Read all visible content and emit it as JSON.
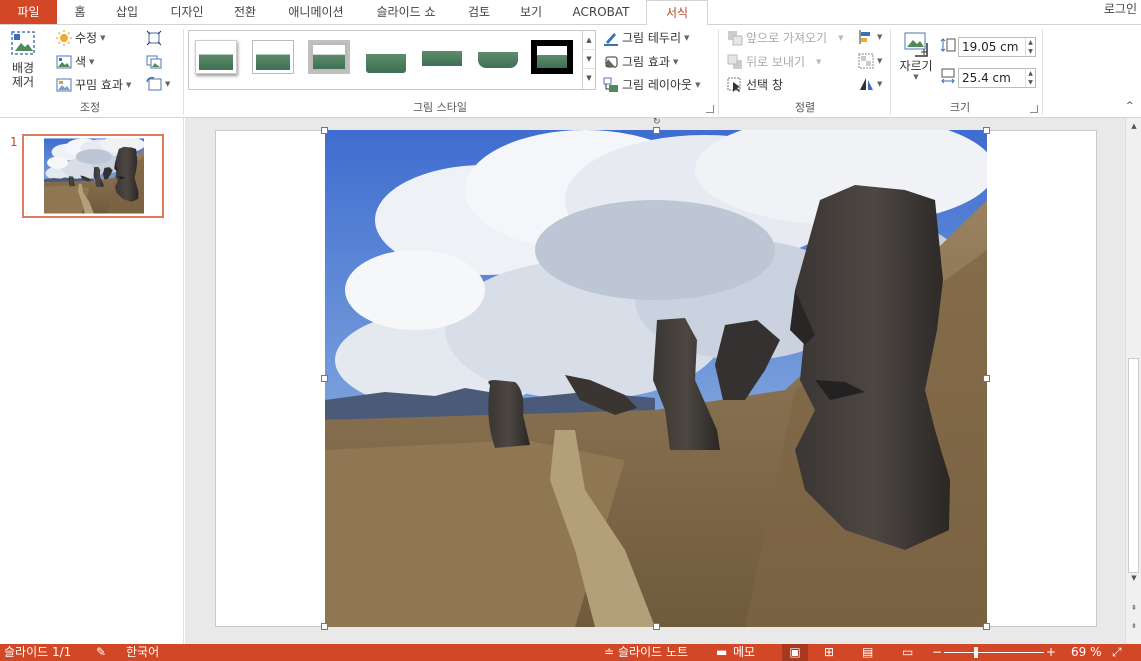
{
  "tabs": {
    "file": "파일",
    "home": "홈",
    "insert": "삽입",
    "design": "디자인",
    "transitions": "전환",
    "animations": "애니메이션",
    "slideshow": "슬라이드 쇼",
    "review": "검토",
    "view": "보기",
    "acrobat": "ACROBAT",
    "format": "서식",
    "login": "로그인"
  },
  "ribbon": {
    "adjust": {
      "remove_bg_line1": "배경",
      "remove_bg_line2": "제거",
      "corrections": "수정",
      "color": "색",
      "artistic": "꾸밈 효과",
      "label": "조정"
    },
    "picture_styles": {
      "border": "그림 테두리",
      "effects": "그림 효과",
      "layout": "그림 레이아웃",
      "label": "그림 스타일"
    },
    "arrange": {
      "bring_forward": "앞으로 가져오기",
      "send_backward": "뒤로 보내기",
      "selection_pane": "선택 창",
      "label": "정렬"
    },
    "size": {
      "crop": "자르기",
      "height": "19.05 cm",
      "width": "25.4 cm",
      "label": "크기"
    }
  },
  "thumbnail_pane": {
    "slide_number": "1"
  },
  "statusbar": {
    "slide_info": "슬라이드 1/1",
    "language": "한국어",
    "notes": "슬라이드 노트",
    "comments": "메모",
    "zoom": "69 %"
  },
  "colors": {
    "accent": "#d24726",
    "active_tab_text": "#b7472a",
    "thumb_selection": "#e07a5f"
  }
}
